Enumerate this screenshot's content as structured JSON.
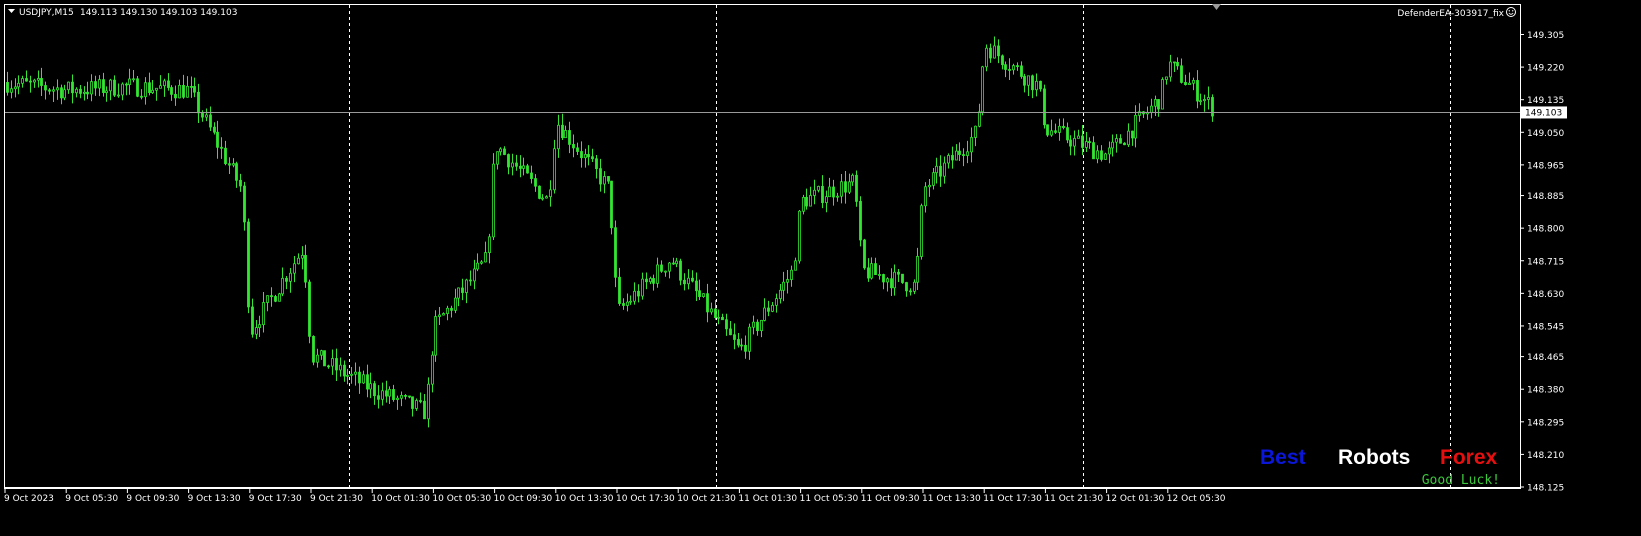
{
  "header": {
    "symbol": "USDJPY,M15",
    "ohlc": "149.113 149.130 149.103 149.103",
    "expert": "DefenderEA-303917_fix"
  },
  "watermark": {
    "word1": "Best",
    "word2": "Robots",
    "word3": "Forex",
    "tagline": "Good Luck!"
  },
  "colors": {
    "background": "#000000",
    "candle": "#32e632",
    "grid": "#ffffff",
    "bid_line": "#9a9a9a",
    "word1": "#0a16d8",
    "word2": "#ffffff",
    "word3": "#e60f0f",
    "tagline": "#3cc83c"
  },
  "icons": {
    "dropdown": "triangle-down-icon",
    "expert": "smiley-icon"
  },
  "chart_data": {
    "type": "candlestick",
    "title": "USDJPY,M15",
    "ylim": [
      148.1,
      149.36
    ],
    "yticks": [
      "149.305",
      "149.220",
      "149.135",
      "149.050",
      "148.965",
      "148.885",
      "148.800",
      "148.715",
      "148.630",
      "148.545",
      "148.465",
      "148.380",
      "148.295",
      "148.210",
      "148.125"
    ],
    "current_price": "149.103",
    "xticks": [
      "9 Oct 2023",
      "9 Oct 05:30",
      "9 Oct 09:30",
      "9 Oct 13:30",
      "9 Oct 17:30",
      "9 Oct 21:30",
      "10 Oct 01:30",
      "10 Oct 05:30",
      "10 Oct 09:30",
      "10 Oct 13:30",
      "10 Oct 17:30",
      "10 Oct 21:30",
      "11 Oct 01:30",
      "11 Oct 05:30",
      "11 Oct 09:30",
      "11 Oct 13:30",
      "11 Oct 17:30",
      "11 Oct 21:30",
      "12 Oct 01:30",
      "12 Oct 05:30"
    ],
    "day_separators": [
      "10 Oct",
      "11 Oct",
      "12 Oct",
      "13 Oct"
    ],
    "grid": false,
    "series": [
      {
        "x": [
          "9 Oct 2023",
          "9 Oct 05:30",
          "9 Oct 09:30",
          "9 Oct 13:30",
          "9 Oct 15:30",
          "9 Oct 17:30",
          "9 Oct 19:30",
          "9 Oct 21:30",
          "10 Oct 01:30",
          "10 Oct 03:30",
          "10 Oct 05:30",
          "10 Oct 07:30",
          "10 Oct 09:30",
          "10 Oct 11:30",
          "10 Oct 13:30",
          "10 Oct 15:30",
          "10 Oct 17:30",
          "10 Oct 19:30",
          "10 Oct 21:30",
          "11 Oct 01:30",
          "11 Oct 03:30",
          "11 Oct 05:30",
          "11 Oct 07:30",
          "11 Oct 09:30",
          "11 Oct 11:30",
          "11 Oct 13:30",
          "11 Oct 15:30",
          "11 Oct 17:30",
          "11 Oct 19:30",
          "11 Oct 21:30",
          "12 Oct 01:30",
          "12 Oct 03:30",
          "12 Oct 05:30",
          "12 Oct 07:00"
        ],
        "y": [
          149.18,
          149.16,
          149.17,
          149.16,
          148.9,
          148.53,
          148.75,
          148.47,
          148.38,
          148.32,
          148.54,
          148.72,
          149.02,
          148.87,
          149.08,
          148.9,
          148.58,
          148.72,
          148.69,
          148.48,
          148.69,
          148.87,
          148.92,
          148.69,
          148.65,
          148.9,
          149.05,
          149.28,
          149.17,
          149.06,
          148.99,
          149.14,
          149.23,
          149.11
        ]
      }
    ]
  }
}
